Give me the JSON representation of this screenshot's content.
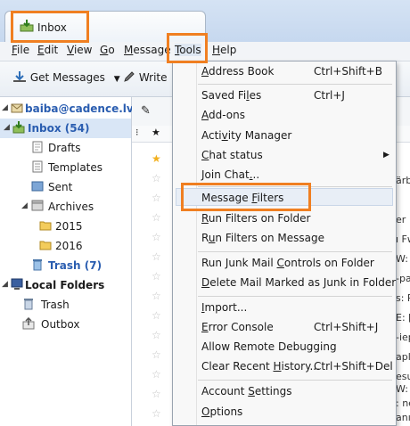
{
  "tab": {
    "title": "Inbox"
  },
  "menubar": [
    {
      "label": "File",
      "u": "F",
      "rest": "ile"
    },
    {
      "label": "Edit",
      "u": "E",
      "rest": "dit"
    },
    {
      "label": "View",
      "u": "V",
      "rest": "iew"
    },
    {
      "label": "Go",
      "u": "G",
      "rest": "o"
    },
    {
      "label": "Message",
      "u": "M",
      "rest": "essage"
    },
    {
      "label": "Tools",
      "u": "T",
      "rest": "ools"
    },
    {
      "label": "Help",
      "u": "H",
      "rest": "elp"
    }
  ],
  "toolbar": {
    "get_messages": "Get Messages",
    "write": "Write"
  },
  "sidebar": {
    "account": "baiba@cadence.lv",
    "inbox": "Inbox (54)",
    "drafts": "Drafts",
    "templates": "Templates",
    "sent": "Sent",
    "archives": "Archives",
    "y2015": "2015",
    "y2016": "2016",
    "trash": "Trash (7)",
    "local_folders": "Local Folders",
    "local_trash": "Trash",
    "outbox": "Outbox"
  },
  "edge_fragments": [
    "ärb",
    "er",
    "ı Fw",
    "W: ",
    "-pa",
    "s: R",
    "E: [",
    "-iep",
    "apl",
    "esu",
    "W: ",
    ": ne",
    "anı"
  ],
  "tools_menu": {
    "items": [
      {
        "pre": "",
        "u": "A",
        "post": "ddress Book",
        "shortcut": "Ctrl+Shift+B"
      },
      {
        "pre": "Saved Fi",
        "u": "l",
        "post": "es",
        "shortcut": "Ctrl+J"
      },
      {
        "pre": "",
        "u": "A",
        "post": "dd-ons",
        "shortcut": ""
      },
      {
        "pre": "Acti",
        "u": "v",
        "post": "ity Manager",
        "shortcut": ""
      },
      {
        "pre": "",
        "u": "C",
        "post": "hat status",
        "shortcut": ""
      },
      {
        "pre": "Join Chat",
        "u": ".",
        "post": "..",
        "shortcut": ""
      },
      {
        "pre": "Message ",
        "u": "F",
        "post": "ilters",
        "shortcut": ""
      },
      {
        "pre": "",
        "u": "R",
        "post": "un Filters on Folder",
        "shortcut": ""
      },
      {
        "pre": "R",
        "u": "u",
        "post": "n Filters on Message",
        "shortcut": ""
      },
      {
        "pre": "Run Junk Mail ",
        "u": "C",
        "post": "ontrols on Folder",
        "shortcut": ""
      },
      {
        "pre": "",
        "u": "D",
        "post": "elete Mail Marked as Junk in Folder",
        "shortcut": ""
      },
      {
        "pre": "",
        "u": "I",
        "post": "mport...",
        "shortcut": ""
      },
      {
        "pre": "",
        "u": "E",
        "post": "rror Console",
        "shortcut": "Ctrl+Shift+J"
      },
      {
        "pre": "Allow Remote Debugging",
        "u": "",
        "post": "",
        "shortcut": ""
      },
      {
        "pre": "Clear Recent ",
        "u": "H",
        "post": "istory...",
        "shortcut": "Ctrl+Shift+Del"
      },
      {
        "pre": "Account ",
        "u": "S",
        "post": "ettings",
        "shortcut": ""
      },
      {
        "pre": "",
        "u": "O",
        "post": "ptions",
        "shortcut": ""
      }
    ]
  },
  "colors": {
    "highlight": "#f07f21",
    "accent": "#2a5db0"
  }
}
